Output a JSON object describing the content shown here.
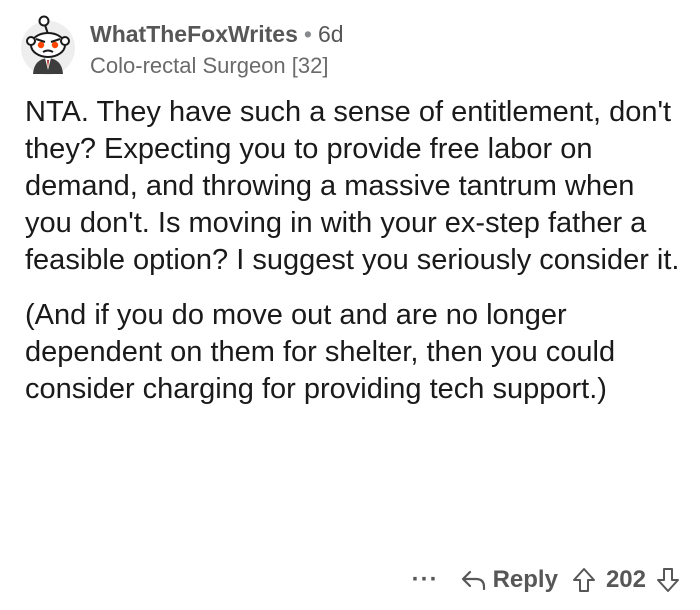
{
  "comment": {
    "author": "WhatTheFoxWrites",
    "separator": "•",
    "age": "6d",
    "flair": "Colo-rectal Surgeon [32]",
    "paragraphs": [
      "NTA. They have such a sense of entitlement, don't they? Expecting you to provide free labor on demand, and throwing a massive tantrum when you don't. Is moving in with your ex-step father a feasible option? I suggest you seriously consider it.",
      "(And if you do move out and are no longer dependent on them for shelter, then you could consider charging for providing tech support.)"
    ],
    "actions": {
      "more_label": "···",
      "reply_label": "Reply",
      "score": "202"
    }
  },
  "icons": {
    "avatar": "snoo-avatar-icon",
    "reply": "reply-arrow-icon",
    "upvote": "upvote-arrow-icon",
    "downvote": "downvote-arrow-icon"
  }
}
